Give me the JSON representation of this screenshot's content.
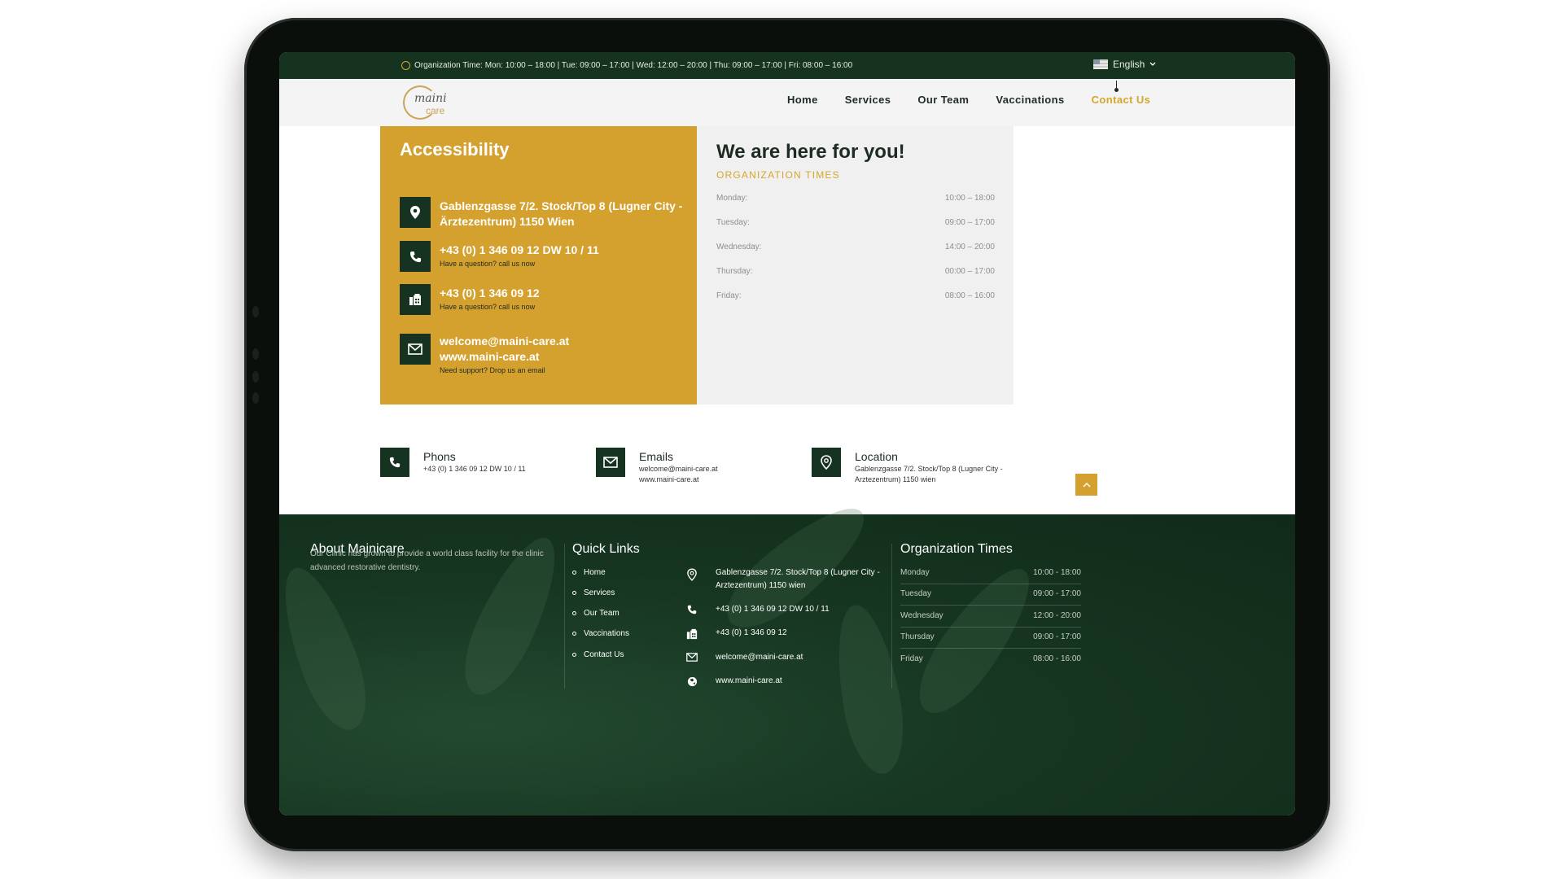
{
  "topbar": {
    "hours_text": "Organization Time: Mon: 10:00 – 18:00 | Tue: 09:00 – 17:00 | Wed: 12:00 – 20:00 | Thu: 09:00 – 17:00 | Fri: 08:00 – 16:00",
    "language": "English"
  },
  "header": {
    "logo_line1": "maini",
    "logo_line2": "care",
    "nav": [
      "Home",
      "Services",
      "Our Team",
      "Vaccinations",
      "Contact Us"
    ]
  },
  "accessibility": {
    "title": "Accessibility",
    "address": "Gablenzgasse 7/2. Stock/Top 8 (Lugner City - Ärztezentrum) 1150 Wien",
    "phone1": "+43 (0) 1 346 09 12 DW 10 / 11",
    "phone1_note": "Have a question? call us now",
    "phone2": "+43 (0) 1 346 09 12",
    "phone2_note": "Have a question? call us now",
    "email": "welcome@maini-care.at",
    "web": "www.maini-care.at",
    "email_note": "Need support? Drop us an email"
  },
  "times": {
    "title": "We are here for you!",
    "subtitle": "ORGANIZATION TIMES",
    "rows": [
      {
        "day": "Monday:",
        "time": "10:00 – 18:00"
      },
      {
        "day": "Tuesday:",
        "time": "09:00 – 17:00"
      },
      {
        "day": "Wednesday:",
        "time": "14:00 – 20:00"
      },
      {
        "day": "Thursday:",
        "time": "00:00 – 17:00"
      },
      {
        "day": "Friday:",
        "time": "08:00 – 16:00"
      }
    ]
  },
  "contact_strip": {
    "phone_title": "Phons",
    "phone_desc": "+43 (0) 1 346 09 12 DW 10 / 11",
    "email_title": "Emails",
    "email_desc1": "welcome@maini-care.at",
    "email_desc2": "www.maini-care.at",
    "location_title": "Location",
    "location_desc1": "Gablenzgasse 7/2. Stock/Top 8 (Lugner City -",
    "location_desc2": "Arztezentrum) 1150 wien"
  },
  "footer": {
    "about_title": "About Mainicare",
    "about_text": "Our Clinic has grown to provide a world class facility for the clinic advanced restorative dentistry.",
    "quick_title": "Quick Links",
    "quick_links": [
      "Home",
      "Services",
      "Our Team",
      "Vaccinations",
      "Contact Us"
    ],
    "address": "Gablenzgasse 7/2. Stock/Top 8 (Lugner City - Arztezentrum) 1150 wien",
    "phone1": "+43 (0) 1 346 09 12 DW 10 / 11",
    "phone2": "+43 (0) 1 346 09 12",
    "email": "welcome@maini-care.at",
    "web": "www.maini-care.at",
    "org_title": "Organization Times",
    "org_rows": [
      {
        "day": "Monday",
        "time": "10:00 - 18:00"
      },
      {
        "day": "Tuesday",
        "time": "09:00 - 17:00"
      },
      {
        "day": "Wednesday",
        "time": "12:00 - 20:00"
      },
      {
        "day": "Thursday",
        "time": "09:00 - 17:00"
      },
      {
        "day": "Friday",
        "time": "08:00 - 16:00"
      }
    ]
  },
  "colors": {
    "dark_green": "#163322",
    "gold": "#d4a12f",
    "nav_active": "#d4a72c"
  },
  "icons": [
    "clock-icon",
    "flag-icon",
    "chevron-down-icon",
    "map-pin-icon",
    "phone-icon",
    "fax-icon",
    "mail-icon",
    "globe-icon",
    "chevron-up-icon"
  ]
}
